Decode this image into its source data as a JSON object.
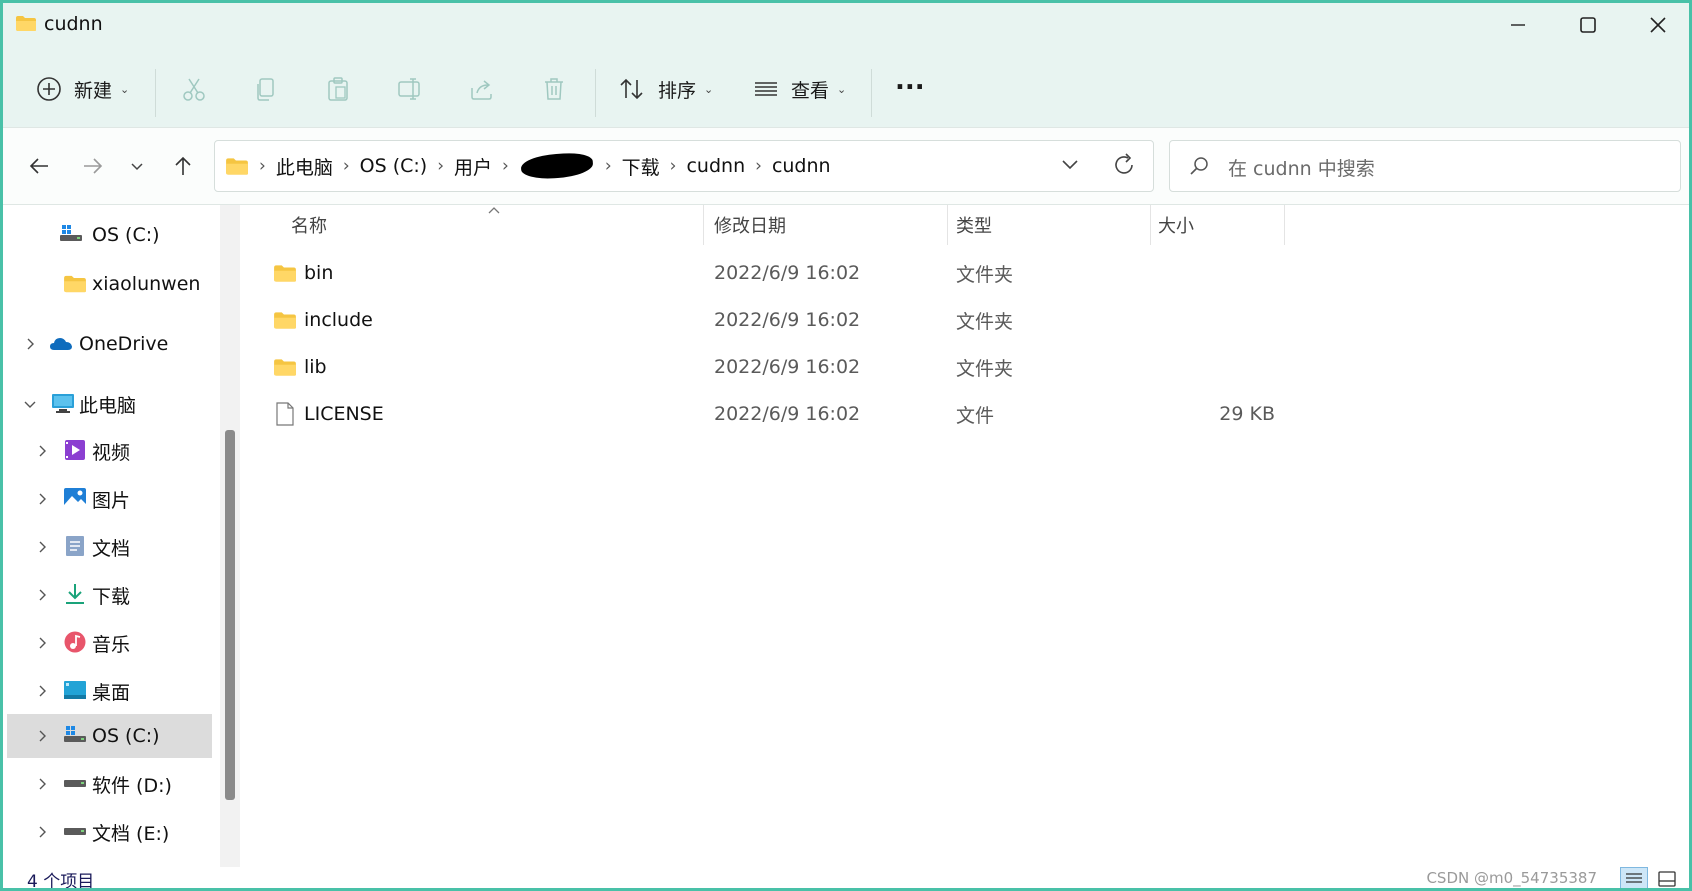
{
  "window": {
    "title": "cudnn",
    "accent": "#49c1a8"
  },
  "toolbar": {
    "new_label": "新建",
    "sort_label": "排序",
    "view_label": "查看",
    "more_label": "..."
  },
  "address": {
    "crumbs": [
      "此电脑",
      "OS (C:)",
      "用户",
      "下载",
      "cudnn",
      "cudnn"
    ]
  },
  "search": {
    "placeholder": "在 cudnn 中搜索"
  },
  "sidebar": {
    "items": [
      {
        "label": "OS (C:)",
        "icon": "drive-c-icon"
      },
      {
        "label": "xiaolunwen",
        "icon": "folder-icon"
      },
      {
        "label": "OneDrive",
        "icon": "onedrive-icon"
      },
      {
        "label": "此电脑",
        "icon": "computer-icon"
      },
      {
        "label": "视频",
        "icon": "video-icon"
      },
      {
        "label": "图片",
        "icon": "pictures-icon"
      },
      {
        "label": "文档",
        "icon": "documents-icon"
      },
      {
        "label": "下载",
        "icon": "download-icon"
      },
      {
        "label": "音乐",
        "icon": "music-icon"
      },
      {
        "label": "桌面",
        "icon": "desktop-icon"
      },
      {
        "label": "OS (C:)",
        "icon": "drive-c-icon"
      },
      {
        "label": "软件 (D:)",
        "icon": "drive-icon"
      },
      {
        "label": "文档 (E:)",
        "icon": "drive-icon"
      }
    ]
  },
  "columns": {
    "name": "名称",
    "date": "修改日期",
    "type": "类型",
    "size": "大小"
  },
  "files": [
    {
      "name": "bin",
      "date": "2022/6/9 16:02",
      "type": "文件夹",
      "size": "",
      "icon": "folder-icon"
    },
    {
      "name": "include",
      "date": "2022/6/9 16:02",
      "type": "文件夹",
      "size": "",
      "icon": "folder-icon"
    },
    {
      "name": "lib",
      "date": "2022/6/9 16:02",
      "type": "文件夹",
      "size": "",
      "icon": "folder-icon"
    },
    {
      "name": "LICENSE",
      "date": "2022/6/9 16:02",
      "type": "文件",
      "size": "29 KB",
      "icon": "file-icon"
    }
  ],
  "status": {
    "count": "4 个项目",
    "watermark": "CSDN @m0_54735387"
  }
}
